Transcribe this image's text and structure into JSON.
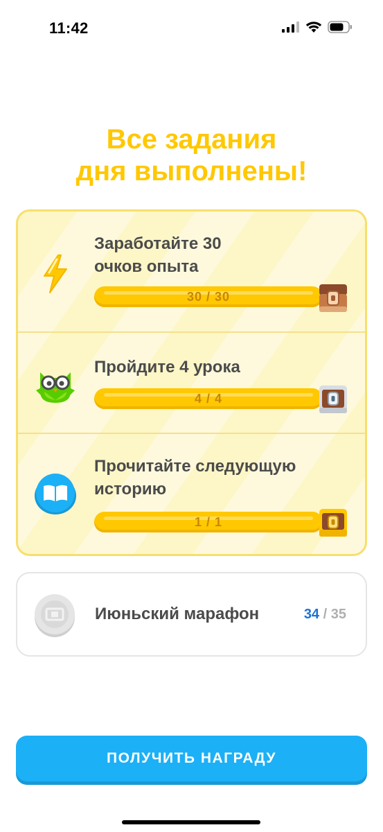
{
  "status_bar": {
    "time": "11:42"
  },
  "title": {
    "line1": "Все задания",
    "line2": "дня выполнены!"
  },
  "quests": [
    {
      "title_line1": "Заработайте 30",
      "title_line2": "очков опыта",
      "progress_text": "30 / 30",
      "progress_fraction": 1.0,
      "icon": "lightning-icon",
      "reward": "chest-opened-icon"
    },
    {
      "title_line1": "Пройдите 4 урока",
      "progress_text": "4 / 4",
      "progress_fraction": 1.0,
      "icon": "owl-icon",
      "reward": "chest-silver-icon"
    },
    {
      "title_line1": "Прочитайте следующую",
      "title_line2": "историю",
      "progress_text": "1 / 1",
      "progress_fraction": 1.0,
      "icon": "book-icon",
      "reward": "chest-gold-icon"
    }
  ],
  "monthly": {
    "title": "Июньский марафон",
    "current": "34",
    "separator": "/",
    "total": "35",
    "icon": "badge-icon"
  },
  "claim_button": {
    "label": "ПОЛУЧИТЬ НАГРАДУ"
  },
  "colors": {
    "accent_yellow": "#ffc800",
    "button_blue": "#1cb0f6",
    "progress_current_blue": "#1a73d9"
  }
}
